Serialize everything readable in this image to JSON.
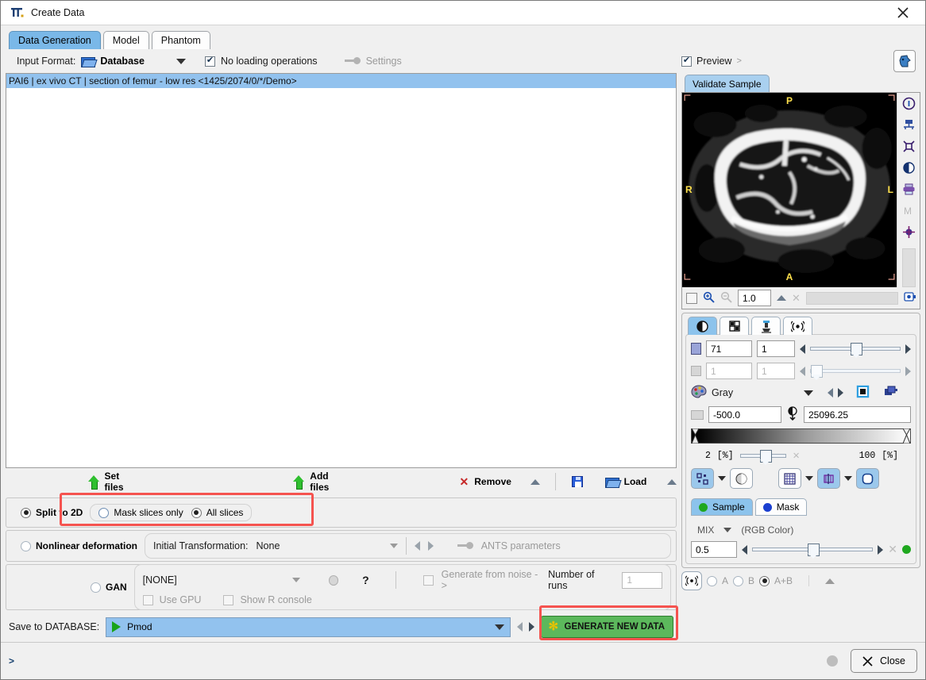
{
  "window": {
    "title": "Create Data",
    "close_icon": "close-icon",
    "app_icon": "pmod-logo-icon"
  },
  "tabs": [
    {
      "label": "Data Generation",
      "active": true
    },
    {
      "label": "Model",
      "active": false
    },
    {
      "label": "Phantom",
      "active": false
    }
  ],
  "input_row": {
    "label": "Input Format:",
    "format_value": "Database",
    "folder_icon": "open-folder-icon",
    "no_loading_ops": {
      "label": "No loading operations",
      "checked": true
    },
    "settings": {
      "label": "Settings",
      "enabled": false,
      "icon": "key-icon"
    }
  },
  "preview": {
    "label": "Preview",
    "checked": true,
    "expand_glyph": ">"
  },
  "head_button": {
    "icon": "head-profile-icon"
  },
  "file_list": {
    "selected_entry": "PAI6 | ex vivo CT | section of femur - low res <1425/2074/0/*/Demo>"
  },
  "file_tools": {
    "set_files": "Set files",
    "add_files": "Add files",
    "remove": "Remove",
    "load": "Load",
    "save_icon": "floppy-disk-icon",
    "load_icon": "open-folder-icon",
    "remove_icon": "x-mark-icon"
  },
  "split_group": {
    "main": {
      "label": "Split to 2D",
      "selected": true
    },
    "options": [
      {
        "label": "Mask slices only",
        "selected": false
      },
      {
        "label": "All slices",
        "selected": true
      }
    ]
  },
  "nonlinear_group": {
    "main": {
      "label": "Nonlinear deformation",
      "selected": false
    },
    "transform_label": "Initial Transformation:",
    "transform_value": "None",
    "ants_label": "ANTS parameters",
    "ants_icon": "key-icon"
  },
  "gan_group": {
    "main": {
      "label": "GAN",
      "selected": false
    },
    "model_value": "[NONE]",
    "help_glyph": "?",
    "use_gpu": {
      "label": "Use GPU",
      "checked": false
    },
    "show_r_console": {
      "label": "Show R console",
      "checked": false
    },
    "generate_from_noise": {
      "label": "Generate from noise ->",
      "checked": false
    },
    "number_of_runs_label": "Number of runs",
    "number_of_runs_value": "1"
  },
  "save_row": {
    "label": "Save to DATABASE:",
    "database_value": "Pmod",
    "generate_button": "GENERATE NEW DATA"
  },
  "viewer": {
    "tab_label": "Validate Sample",
    "orientation": {
      "top": "P",
      "left": "R",
      "right": "L",
      "bottom": "A"
    },
    "side_tools": [
      "info-icon",
      "layout-icon",
      "fit-to-window-icon",
      "contrast-icon",
      "print-icon",
      "m-marker-icon",
      "crosshair-icon"
    ],
    "zoom_row": {
      "checkbox": false,
      "zoom_in_icon": "zoom-in-icon",
      "zoom_out_icon": "zoom-out-icon",
      "zoom_value": "1.0",
      "clear_icon": "x-mark-icon",
      "capture_icon": "snapshot-icon"
    }
  },
  "control_panel": {
    "tabs": [
      {
        "icon": "contrast-icon",
        "active": true
      },
      {
        "icon": "grid-layout-icon",
        "active": false
      },
      {
        "icon": "probe-icon",
        "active": false
      },
      {
        "icon": "fusion-icon",
        "active": false
      }
    ],
    "slice_row": {
      "value_a": "71",
      "value_b": "1",
      "enabled": true,
      "icon": "slice-plane-icon"
    },
    "frame_row": {
      "value_a": "1",
      "value_b": "1",
      "enabled": false,
      "icon": "frame-stack-icon"
    },
    "colortable": {
      "name": "Gray",
      "palette_icon": "color-palette-icon",
      "invert_icon": "invert-colors-icon",
      "copy_icon": "copy-colortable-icon"
    },
    "window_min": "-500.0",
    "window_max": "25096.25",
    "threshold_icon": "window-level-icon",
    "pct_min": "2",
    "pct_min_unit": "[%]",
    "pct_max": "100",
    "pct_max_unit": "[%]",
    "tool_buttons": [
      {
        "icon": "markers-icon",
        "active": true
      },
      {
        "icon": "alpha-blend-icon",
        "active": false
      },
      {
        "icon": "grid-overlay-icon",
        "active": false
      },
      {
        "icon": "vessel-overlay-icon",
        "active": true
      },
      {
        "icon": "roi-outline-icon",
        "active": true
      }
    ],
    "layer_tabs": [
      {
        "label": "Sample",
        "color": "#1fa81f",
        "active": true
      },
      {
        "label": "Mask",
        "color": "#1a3fd0",
        "active": false
      }
    ],
    "mix_label": "MIX",
    "rgb_label": "(RGB Color)",
    "mix_value": "0.5",
    "fusion": {
      "icon": "fusion-icon",
      "options": [
        {
          "label": "A",
          "selected": false
        },
        {
          "label": "B",
          "selected": false
        },
        {
          "label": "A+B",
          "selected": true
        }
      ]
    }
  },
  "status_bar": {
    "prompt": ">",
    "close_label": "Close",
    "close_icon": "x-mark-icon"
  },
  "colors": {
    "accent_blue": "#92c2ee",
    "tab_active": "#7ab8e8",
    "highlight_red": "#f5534f",
    "generate_green": "#5cb85c",
    "orientation_yellow": "#ffe14d"
  }
}
